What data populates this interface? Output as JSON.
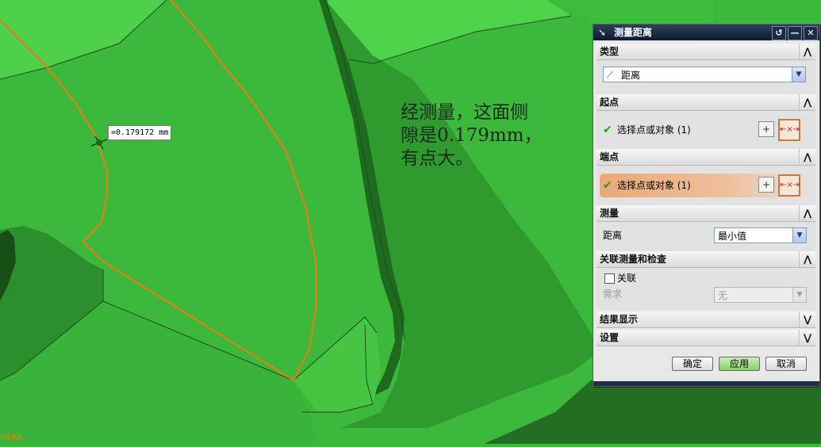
{
  "viewport": {
    "measure_label": "=0.179172 mm",
    "annotation_lines": [
      "经测量，这面侧",
      "隙是0.179mm，",
      "有点大。"
    ],
    "camera_label": "MERA",
    "colors": {
      "face_main": "#3cb83c",
      "face_light": "#4fd04a",
      "face_dark": "#1e5f1e",
      "edge_highlight": "#f07a14"
    }
  },
  "dialog": {
    "title": "测量距离",
    "title_icon": "cursor-arrow-icon",
    "controls": {
      "reset": "↺",
      "minimize": "—",
      "close": "✕"
    },
    "sections": {
      "type": {
        "header": "类型",
        "selected": "距离"
      },
      "start_point": {
        "header": "起点",
        "select_label": "选择点或对象 (1)"
      },
      "end_point": {
        "header": "端点",
        "select_label": "选择点或对象 (1)"
      },
      "measure": {
        "header": "测量",
        "field_label": "距离",
        "selected": "最小值"
      },
      "associate": {
        "header": "关联测量和检查",
        "checkbox_label": "关联",
        "req_label": "需求",
        "req_value": "无"
      },
      "result_display": {
        "header": "结果显示"
      },
      "settings": {
        "header": "设置"
      }
    },
    "buttons": {
      "ok": "确定",
      "apply": "应用",
      "cancel": "取消"
    }
  }
}
